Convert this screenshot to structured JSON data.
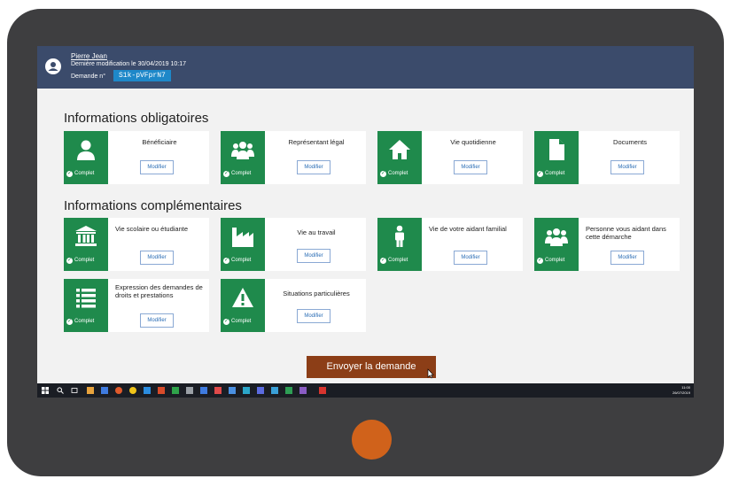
{
  "header": {
    "user_name": "Pierre Jean",
    "last_modified": "Dernière modification le 30/04/2019 10:17",
    "demande_label": "Demande n°",
    "demande_number": "S1k-pVFprN7"
  },
  "sections": {
    "obligatoires": "Informations obligatoires",
    "complementaires": "Informations complémentaires"
  },
  "status_label": "Complet",
  "modify_label": "Modifier",
  "cards": {
    "beneficiaire": "Bénéficiaire",
    "representant": "Représentant légal",
    "vie_quotidienne": "Vie quotidienne",
    "documents": "Documents",
    "vie_scolaire": "Vie scolaire ou étudiante",
    "vie_travail": "Vie au travail",
    "vie_aidant": "Vie de votre aidant familial",
    "personne_aidant": "Personne vous aidant dans cette démarche",
    "expression": "Expression des demandes de droits et prestations",
    "situations": "Situations particulières"
  },
  "send_button": "Envoyer la demande",
  "taskbar": {
    "time": "11:00",
    "date": "26/07/2019"
  },
  "colors": {
    "header": "#3b4b6b",
    "complete_green": "#1f8a4c",
    "send_button": "#8c3e17",
    "home_button": "#d0621b",
    "badge_blue": "#1e88c9"
  }
}
